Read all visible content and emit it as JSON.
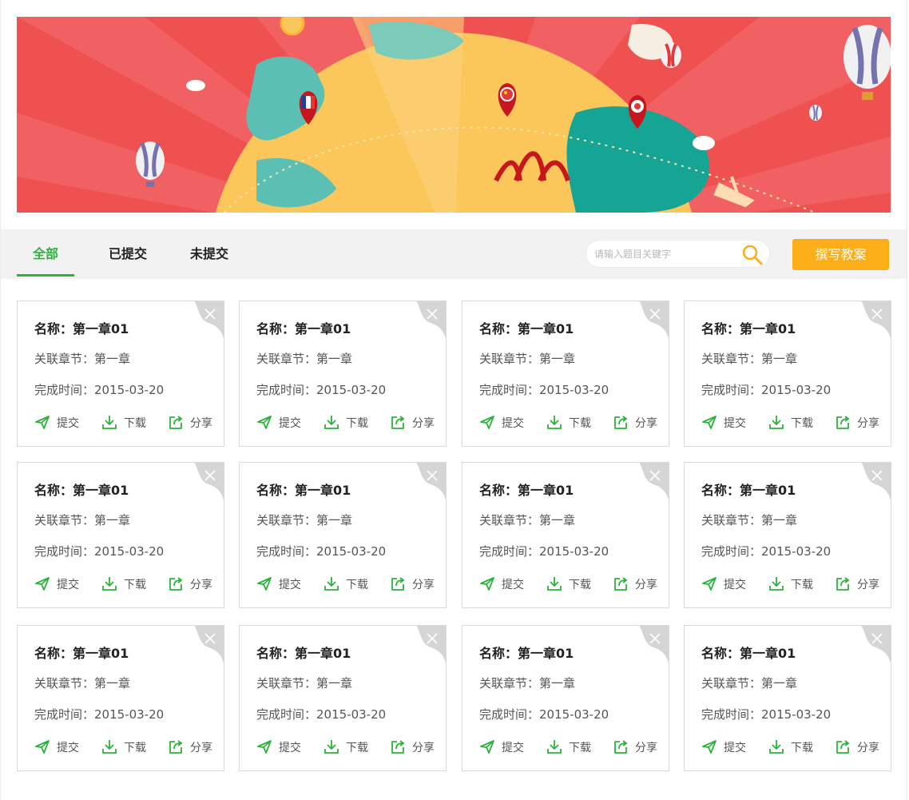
{
  "banner": {
    "alt": "travel world map banner"
  },
  "tabs": [
    {
      "label": "全部",
      "active": true
    },
    {
      "label": "已提交",
      "active": false
    },
    {
      "label": "未提交",
      "active": false
    }
  ],
  "search": {
    "placeholder": "请输入题目关键字",
    "value": "",
    "icon": "search-icon"
  },
  "write_button": "撰写教案",
  "card_actions": {
    "submit": "提交",
    "download": "下载",
    "share": "分享"
  },
  "cards": [
    {
      "name": "名称：第一章01",
      "chapter": "关联章节：第一章",
      "date": "完成时间：2015-03-20"
    },
    {
      "name": "名称：第一章01",
      "chapter": "关联章节：第一章",
      "date": "完成时间：2015-03-20"
    },
    {
      "name": "名称：第一章01",
      "chapter": "关联章节：第一章",
      "date": "完成时间：2015-03-20"
    },
    {
      "name": "名称：第一章01",
      "chapter": "关联章节：第一章",
      "date": "完成时间：2015-03-20"
    },
    {
      "name": "名称：第一章01",
      "chapter": "关联章节：第一章",
      "date": "完成时间：2015-03-20"
    },
    {
      "name": "名称：第一章01",
      "chapter": "关联章节：第一章",
      "date": "完成时间：2015-03-20"
    },
    {
      "name": "名称：第一章01",
      "chapter": "关联章节：第一章",
      "date": "完成时间：2015-03-20"
    },
    {
      "name": "名称：第一章01",
      "chapter": "关联章节：第一章",
      "date": "完成时间：2015-03-20"
    },
    {
      "name": "名称：第一章01",
      "chapter": "关联章节：第一章",
      "date": "完成时间：2015-03-20"
    },
    {
      "name": "名称：第一章01",
      "chapter": "关联章节：第一章",
      "date": "完成时间：2015-03-20"
    },
    {
      "name": "名称：第一章01",
      "chapter": "关联章节：第一章",
      "date": "完成时间：2015-03-20"
    },
    {
      "name": "名称：第一章01",
      "chapter": "关联章节：第一章",
      "date": "完成时间：2015-03-20"
    }
  ],
  "colors": {
    "accent_green": "#2cb23a",
    "button_orange": "#fbae17",
    "banner_red": "#ef5150",
    "toolbar_bg": "#f2f2f2"
  }
}
